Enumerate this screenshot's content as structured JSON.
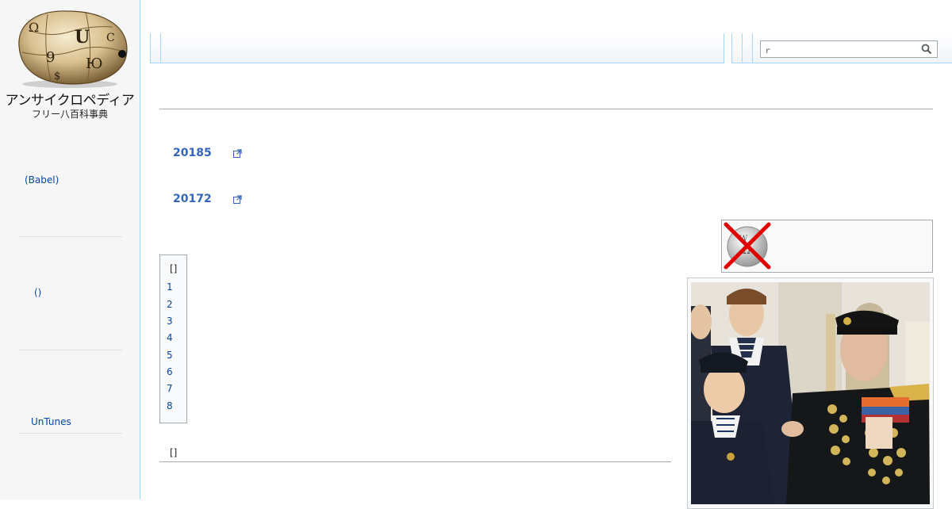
{
  "logo": {
    "title": "アンサイクロペディア",
    "subtitle": "フリー八百科事典"
  },
  "sidebar": {
    "items": [
      {
        "label": "(Babel)"
      },
      {
        "label": "()"
      },
      {
        "label": "UnTunes"
      }
    ]
  },
  "search": {
    "value": "ｒ"
  },
  "content": {
    "links": [
      {
        "label": "20185"
      },
      {
        "label": "20172"
      }
    ],
    "toc": {
      "title": "[]",
      "items": [
        "1",
        "2",
        "3",
        "4",
        "5",
        "6",
        "7",
        "8"
      ]
    },
    "section_edit": "[]"
  },
  "icons": {
    "search": "search-icon",
    "external": "external-link-icon",
    "notice": "wikipedia-crossed-icon"
  },
  "colors": {
    "link": "#0645ad",
    "bold_link": "#3366bb",
    "border": "#a7d7f9"
  }
}
